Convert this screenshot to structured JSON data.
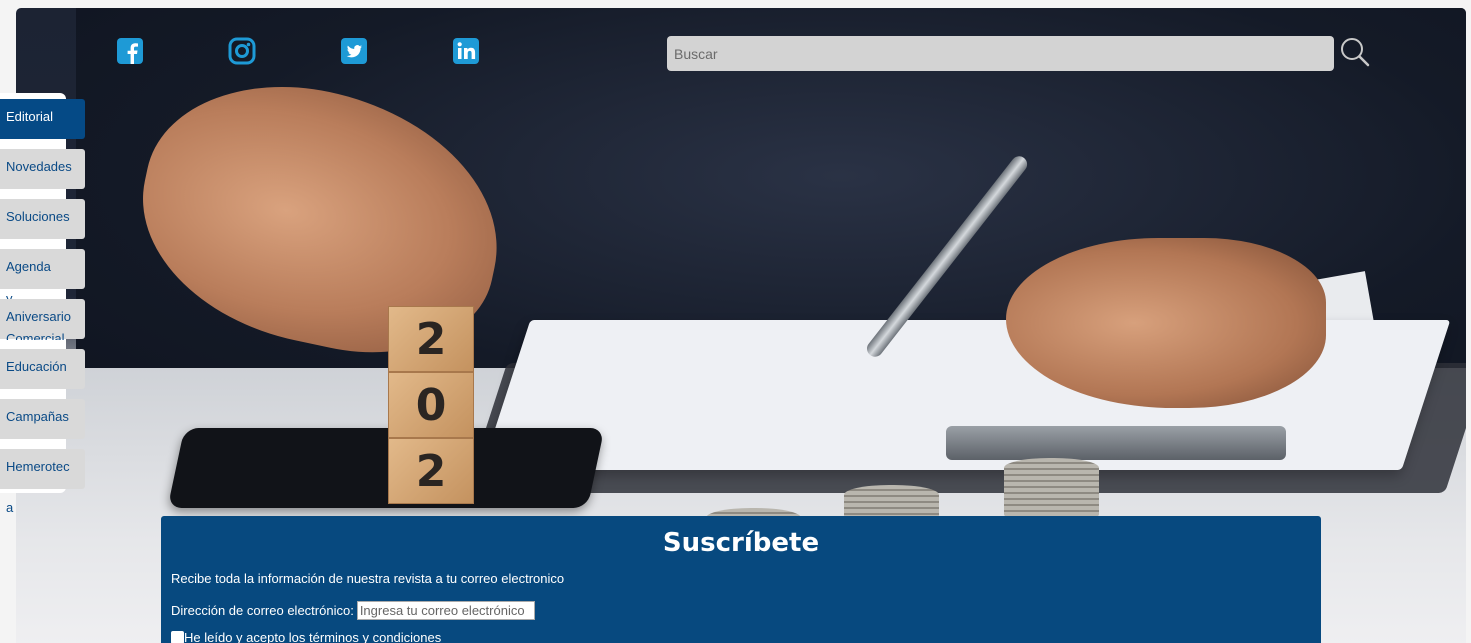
{
  "header": {
    "social": [
      {
        "icon": "facebook-icon",
        "color": "#1e9ad6"
      },
      {
        "icon": "instagram-icon",
        "color": "#1e9ad6"
      },
      {
        "icon": "twitter-icon",
        "color": "#1e9ad6"
      },
      {
        "icon": "linkedin-icon",
        "color": "#1e9ad6"
      }
    ],
    "search": {
      "placeholder": "Buscar",
      "icon": "search-icon"
    }
  },
  "sidebar": {
    "items": [
      {
        "label": "Editorial",
        "active": true
      },
      {
        "label": "Novedades"
      },
      {
        "label": "Soluciones"
      },
      {
        "label": "Agenda"
      },
      {
        "label": "Aniversario"
      },
      {
        "label": "Educación"
      },
      {
        "label": "Campañas"
      },
      {
        "label": "Hemerotec"
      }
    ],
    "overflow_fragments": [
      "y",
      "Comercial",
      "a"
    ]
  },
  "hero": {
    "blocks": [
      "2",
      "0",
      "2"
    ]
  },
  "subscribe": {
    "title": "Suscríbete",
    "description": "Recibe toda la información de nuestra revista a tu correo electronico",
    "email_label": "Dirección de correo electrónico:",
    "email_placeholder": "Ingresa tu correo electrónico",
    "terms_label": "He leído y acepto los términos y condiciones"
  },
  "colors": {
    "primary": "#054a86",
    "social": "#1e9ad6",
    "tab_bg": "#d9d9d9"
  }
}
